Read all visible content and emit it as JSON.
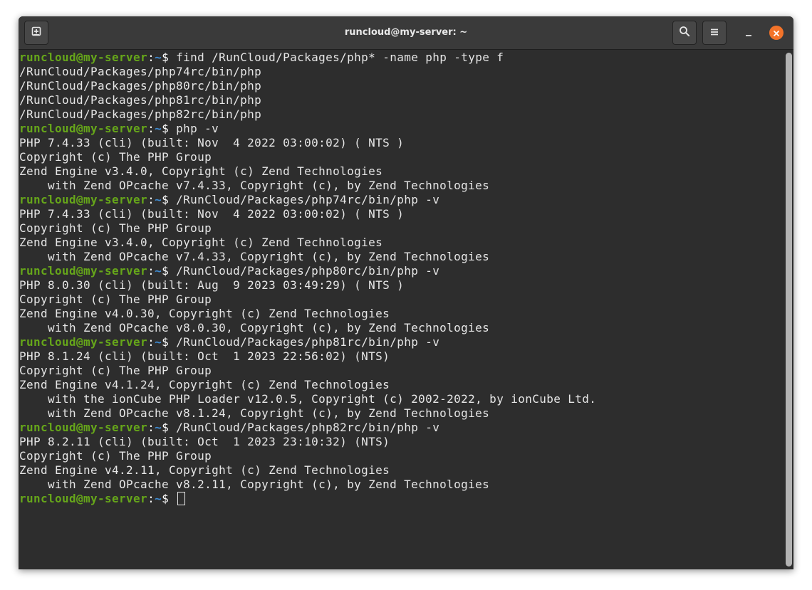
{
  "window": {
    "title": "runcloud@my-server: ~",
    "icons": {
      "new_tab": "new-tab-icon",
      "search": "search-icon",
      "menu": "hamburger-menu-icon",
      "minimize": "minimize-icon",
      "close": "close-icon"
    },
    "colors": {
      "prompt_user": "#66a61a",
      "prompt_path": "#3f8bd1",
      "text": "#e6e6e6",
      "background": "#2d2d2d",
      "close_button": "#f37329"
    }
  },
  "terminal": {
    "lines": [
      {
        "type": "prompt",
        "user": "runcloud@my-server",
        "sep": ":",
        "path": "~",
        "dollar": "$ ",
        "command": "find /RunCloud/Packages/php* -name php -type f"
      },
      {
        "type": "output",
        "text": "/RunCloud/Packages/php74rc/bin/php"
      },
      {
        "type": "output",
        "text": "/RunCloud/Packages/php80rc/bin/php"
      },
      {
        "type": "output",
        "text": "/RunCloud/Packages/php81rc/bin/php"
      },
      {
        "type": "output",
        "text": "/RunCloud/Packages/php82rc/bin/php"
      },
      {
        "type": "prompt",
        "user": "runcloud@my-server",
        "sep": ":",
        "path": "~",
        "dollar": "$ ",
        "command": "php -v"
      },
      {
        "type": "output",
        "text": "PHP 7.4.33 (cli) (built: Nov  4 2022 03:00:02) ( NTS )"
      },
      {
        "type": "output",
        "text": "Copyright (c) The PHP Group"
      },
      {
        "type": "output",
        "text": "Zend Engine v3.4.0, Copyright (c) Zend Technologies"
      },
      {
        "type": "output",
        "text": "    with Zend OPcache v7.4.33, Copyright (c), by Zend Technologies"
      },
      {
        "type": "prompt",
        "user": "runcloud@my-server",
        "sep": ":",
        "path": "~",
        "dollar": "$ ",
        "command": "/RunCloud/Packages/php74rc/bin/php -v"
      },
      {
        "type": "output",
        "text": "PHP 7.4.33 (cli) (built: Nov  4 2022 03:00:02) ( NTS )"
      },
      {
        "type": "output",
        "text": "Copyright (c) The PHP Group"
      },
      {
        "type": "output",
        "text": "Zend Engine v3.4.0, Copyright (c) Zend Technologies"
      },
      {
        "type": "output",
        "text": "    with Zend OPcache v7.4.33, Copyright (c), by Zend Technologies"
      },
      {
        "type": "prompt",
        "user": "runcloud@my-server",
        "sep": ":",
        "path": "~",
        "dollar": "$ ",
        "command": "/RunCloud/Packages/php80rc/bin/php -v"
      },
      {
        "type": "output",
        "text": "PHP 8.0.30 (cli) (built: Aug  9 2023 03:49:29) ( NTS )"
      },
      {
        "type": "output",
        "text": "Copyright (c) The PHP Group"
      },
      {
        "type": "output",
        "text": "Zend Engine v4.0.30, Copyright (c) Zend Technologies"
      },
      {
        "type": "output",
        "text": "    with Zend OPcache v8.0.30, Copyright (c), by Zend Technologies"
      },
      {
        "type": "prompt",
        "user": "runcloud@my-server",
        "sep": ":",
        "path": "~",
        "dollar": "$ ",
        "command": "/RunCloud/Packages/php81rc/bin/php -v"
      },
      {
        "type": "output",
        "text": "PHP 8.1.24 (cli) (built: Oct  1 2023 22:56:02) (NTS)"
      },
      {
        "type": "output",
        "text": "Copyright (c) The PHP Group"
      },
      {
        "type": "output",
        "text": "Zend Engine v4.1.24, Copyright (c) Zend Technologies"
      },
      {
        "type": "output",
        "text": "    with the ionCube PHP Loader v12.0.5, Copyright (c) 2002-2022, by ionCube Ltd."
      },
      {
        "type": "output",
        "text": "    with Zend OPcache v8.1.24, Copyright (c), by Zend Technologies"
      },
      {
        "type": "prompt",
        "user": "runcloud@my-server",
        "sep": ":",
        "path": "~",
        "dollar": "$ ",
        "command": "/RunCloud/Packages/php82rc/bin/php -v"
      },
      {
        "type": "output",
        "text": "PHP 8.2.11 (cli) (built: Oct  1 2023 23:10:32) (NTS)"
      },
      {
        "type": "output",
        "text": "Copyright (c) The PHP Group"
      },
      {
        "type": "output",
        "text": "Zend Engine v4.2.11, Copyright (c) Zend Technologies"
      },
      {
        "type": "output",
        "text": "    with Zend OPcache v8.2.11, Copyright (c), by Zend Technologies"
      },
      {
        "type": "prompt",
        "user": "runcloud@my-server",
        "sep": ":",
        "path": "~",
        "dollar": "$ ",
        "command": "",
        "cursor": true
      }
    ]
  }
}
